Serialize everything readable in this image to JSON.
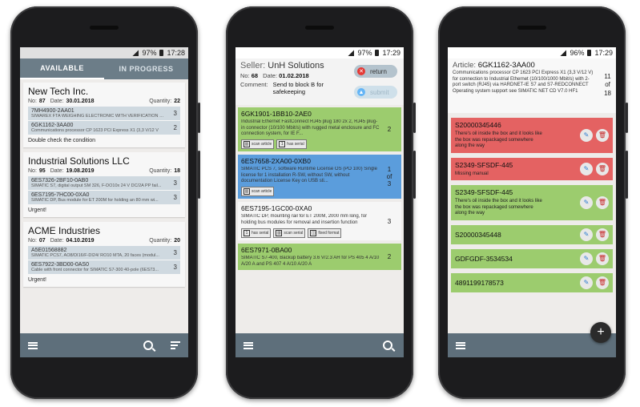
{
  "status": {
    "phone1": {
      "battery": "97%",
      "time": "17:28"
    },
    "phone2": {
      "battery": "97%",
      "time": "17:29"
    },
    "phone3": {
      "battery": "96%",
      "time": "17:29"
    }
  },
  "phone1": {
    "tabs": [
      {
        "label": "AVAILABLE",
        "active": true
      },
      {
        "label": "IN PROGRESS",
        "active": false
      }
    ],
    "labels": {
      "no": "No:",
      "date": "Date:",
      "quantity": "Quantity:"
    },
    "orders": [
      {
        "company": "New Tech Inc.",
        "no": "87",
        "date": "30.01.2018",
        "quantity": "22",
        "items": [
          {
            "code": "7MH4900-2AA01",
            "desc": "SIWAREX FTA WEIGHING ELECTRONIC WITH VERIFICATION C...",
            "qty": "3"
          },
          {
            "code": "6GK1162-3AA00",
            "desc": "Communications processor CP 1623 PCI Express X1 (3,3 V/12 V",
            "qty": "2"
          }
        ],
        "note": "Double check the condition"
      },
      {
        "company": "Industrial Solutions LLC",
        "no": "95",
        "date": "19.08.2019",
        "quantity": "18",
        "items": [
          {
            "code": "6ES7326-2BF10-0AB0",
            "desc": "SIMATIC S7, digital output SM 326, F-DO10x 24 V DC/2A PP fail...",
            "qty": "3"
          },
          {
            "code": "6ES7195-7HC00-0XA0",
            "desc": "SIMATIC DP, Bus module for ET 200M for holding an 80 mm wi...",
            "qty": "3"
          }
        ],
        "note": "Urgent!"
      },
      {
        "company": "ACME Industries",
        "no": "07",
        "date": "04.10.2019",
        "quantity": "20",
        "items": [
          {
            "code": "A5E01568882",
            "desc": "SIMATIC PCS7, AO8/DI16/F-DI24/ RO10 MTA, 20 faces (modul...",
            "qty": "3"
          },
          {
            "code": "6ES7922-3BD00-0AS0",
            "desc": "Cable with front connector for SIMATIC S7-300 40-pole (6ES73...",
            "qty": "3"
          }
        ],
        "note": "Urgent!"
      }
    ]
  },
  "phone2": {
    "seller_label": "Seller:",
    "seller": "UnH Solutions",
    "no_label": "No:",
    "no": "68",
    "date_label": "Date:",
    "date": "01.02.2018",
    "comment_label": "Comment:",
    "comment": "Send to block B for safekeeping",
    "return_label": "return",
    "submit_label": "submit",
    "articles": [
      {
        "code": "6GK1901-1BB10-2AE0",
        "desc": "Industrial Ethernet FastConnect RJ45 plug 180 2x 2, RJ45 plug-in connector (10/100 Mbit/s) with rugged metal enclosure and FC connection system, for IE F...",
        "qty": "2",
        "of": "",
        "total": "",
        "badges": [
          "scan article",
          "has serial"
        ]
      },
      {
        "code": "6ES7658-2XA00-0XB0",
        "desc": "SIMATIC PCS 7, software Runtime License OS (PO 100) Single license for 1 installation R-SW, without SW, without documentation License Key on USB sti...",
        "qty": "1",
        "of": "of",
        "total": "3",
        "badges": [
          "scan article"
        ]
      },
      {
        "code": "6ES7195-1GC00-0XA0",
        "desc": "SIMATIC DP, mounting rail for ET 200M, 2000 mm long, for holding bus modules for removal and insertion function",
        "qty": "3",
        "of": "",
        "total": "",
        "badges": [
          "has serial",
          "scan serial",
          "fixed format"
        ]
      },
      {
        "code": "6ES7971-0BA00",
        "desc": "SIMATIC S7-400, Backup battery 3.6 V/2.3 AH for PS 405 4 A/10 A/20 A and PS 407 4 A/10 A/20 A",
        "qty": "2",
        "of": "",
        "total": "",
        "badges": []
      }
    ]
  },
  "phone3": {
    "article_label": "Article:",
    "article": "6GK1162-3AA00",
    "desc": "Communications processor CP 1623 PCI Express X1 (3,3 V/12 V) for connection to Industrial Ethernet (10/100/1000 Mbit/s) with 2-port switch (RJ45) via HARDNET-IE S7 and S7-REDCONNECT Operating system support see SIMATIC NET CD V7.0 HF1",
    "qty": "11",
    "of": "of",
    "total": "18",
    "serials": [
      {
        "sn": "S20000345446",
        "desc": "There's oil inside the box and it looks like the box was repackaged somewhere along the way",
        "color": "red"
      },
      {
        "sn": "S2349-SFSDF-445",
        "desc": "Missing manual",
        "color": "red"
      },
      {
        "sn": "S2349-SFSDF-445",
        "desc": "There's oil inside the box and it looks like the box was repackaged somewhere along the way",
        "color": "green"
      },
      {
        "sn": "S20000345448",
        "desc": "",
        "color": "green"
      },
      {
        "sn": "GDFGDF-3534534",
        "desc": "",
        "color": "green"
      },
      {
        "sn": "4891199178573",
        "desc": "",
        "color": "green"
      }
    ]
  }
}
